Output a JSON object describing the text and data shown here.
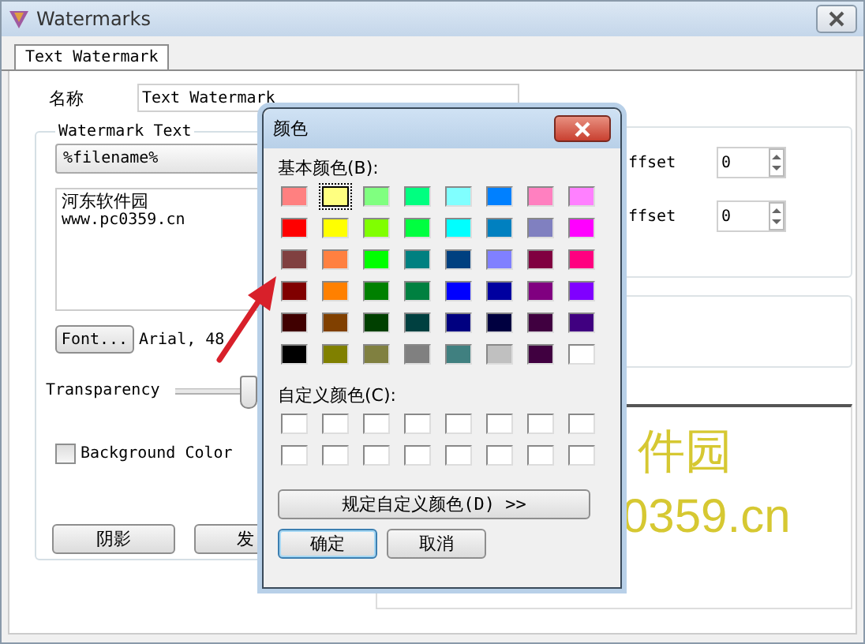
{
  "window": {
    "title": "Watermarks"
  },
  "tabs": [
    {
      "label": "Text Watermark",
      "selected": true
    }
  ],
  "name_field": {
    "label": "名称",
    "value": "Text Watermark"
  },
  "watermark_text": {
    "title": "Watermark Text",
    "combo": "%filename%",
    "text_lines": [
      "河东软件园",
      "www.pc0359.cn"
    ],
    "font_button": "Font...",
    "font_value": "Arial, 48",
    "transparency_label": "Transparency",
    "transparency": {
      "level": 0.45
    },
    "background_color": {
      "label": "Background Color",
      "checked": false
    },
    "buttons": [
      "阴影",
      "发"
    ]
  },
  "offsets": [
    {
      "label": "ffset",
      "value": "0"
    },
    {
      "label": "ffset",
      "value": "0"
    }
  ],
  "preview": {
    "lines": [
      "件园",
      "0359.cn"
    ]
  },
  "color_dialog": {
    "title": "颜色",
    "basic_label": "基本颜色(B):",
    "basic_colors": [
      {
        "color": "#ff8080",
        "selected": false
      },
      {
        "color": "#ffff80",
        "selected": true
      },
      {
        "color": "#80ff80",
        "selected": false
      },
      {
        "color": "#00ff80",
        "selected": false
      },
      {
        "color": "#80ffff",
        "selected": false
      },
      {
        "color": "#0080ff",
        "selected": false
      },
      {
        "color": "#ff80c0",
        "selected": false
      },
      {
        "color": "#ff80ff",
        "selected": false
      },
      {
        "color": "#ff0000",
        "selected": false
      },
      {
        "color": "#ffff00",
        "selected": false
      },
      {
        "color": "#80ff00",
        "selected": false
      },
      {
        "color": "#00ff40",
        "selected": false
      },
      {
        "color": "#00ffff",
        "selected": false
      },
      {
        "color": "#0080c0",
        "selected": false
      },
      {
        "color": "#8080c0",
        "selected": false
      },
      {
        "color": "#ff00ff",
        "selected": false
      },
      {
        "color": "#804040",
        "selected": false
      },
      {
        "color": "#ff8040",
        "selected": false
      },
      {
        "color": "#00ff00",
        "selected": false
      },
      {
        "color": "#008080",
        "selected": false
      },
      {
        "color": "#004080",
        "selected": false
      },
      {
        "color": "#8080ff",
        "selected": false
      },
      {
        "color": "#800040",
        "selected": false
      },
      {
        "color": "#ff0080",
        "selected": false
      },
      {
        "color": "#800000",
        "selected": false
      },
      {
        "color": "#ff8000",
        "selected": false
      },
      {
        "color": "#008000",
        "selected": false
      },
      {
        "color": "#008040",
        "selected": false
      },
      {
        "color": "#0000ff",
        "selected": false
      },
      {
        "color": "#0000a0",
        "selected": false
      },
      {
        "color": "#800080",
        "selected": false
      },
      {
        "color": "#8000ff",
        "selected": false
      },
      {
        "color": "#400000",
        "selected": false
      },
      {
        "color": "#804000",
        "selected": false
      },
      {
        "color": "#004000",
        "selected": false
      },
      {
        "color": "#004040",
        "selected": false
      },
      {
        "color": "#000080",
        "selected": false
      },
      {
        "color": "#000040",
        "selected": false
      },
      {
        "color": "#400040",
        "selected": false
      },
      {
        "color": "#400080",
        "selected": false
      },
      {
        "color": "#000000",
        "selected": false
      },
      {
        "color": "#808000",
        "selected": false
      },
      {
        "color": "#808040",
        "selected": false
      },
      {
        "color": "#808080",
        "selected": false
      },
      {
        "color": "#408080",
        "selected": false
      },
      {
        "color": "#c0c0c0",
        "selected": false
      },
      {
        "color": "#400040",
        "selected": false
      },
      {
        "color": "#ffffff",
        "selected": false
      }
    ],
    "custom_label": "自定义颜色(C):",
    "custom_colors": [
      {
        "color": "#ffffff"
      },
      {
        "color": "#ffffff"
      },
      {
        "color": "#ffffff"
      },
      {
        "color": "#ffffff"
      },
      {
        "color": "#ffffff"
      },
      {
        "color": "#ffffff"
      },
      {
        "color": "#ffffff"
      },
      {
        "color": "#ffffff"
      },
      {
        "color": "#ffffff"
      },
      {
        "color": "#ffffff"
      },
      {
        "color": "#ffffff"
      },
      {
        "color": "#ffffff"
      },
      {
        "color": "#ffffff"
      },
      {
        "color": "#ffffff"
      },
      {
        "color": "#ffffff"
      },
      {
        "color": "#ffffff"
      }
    ],
    "define_button": "规定自定义颜色(D) >>",
    "ok_button": "确定",
    "cancel_button": "取消"
  }
}
